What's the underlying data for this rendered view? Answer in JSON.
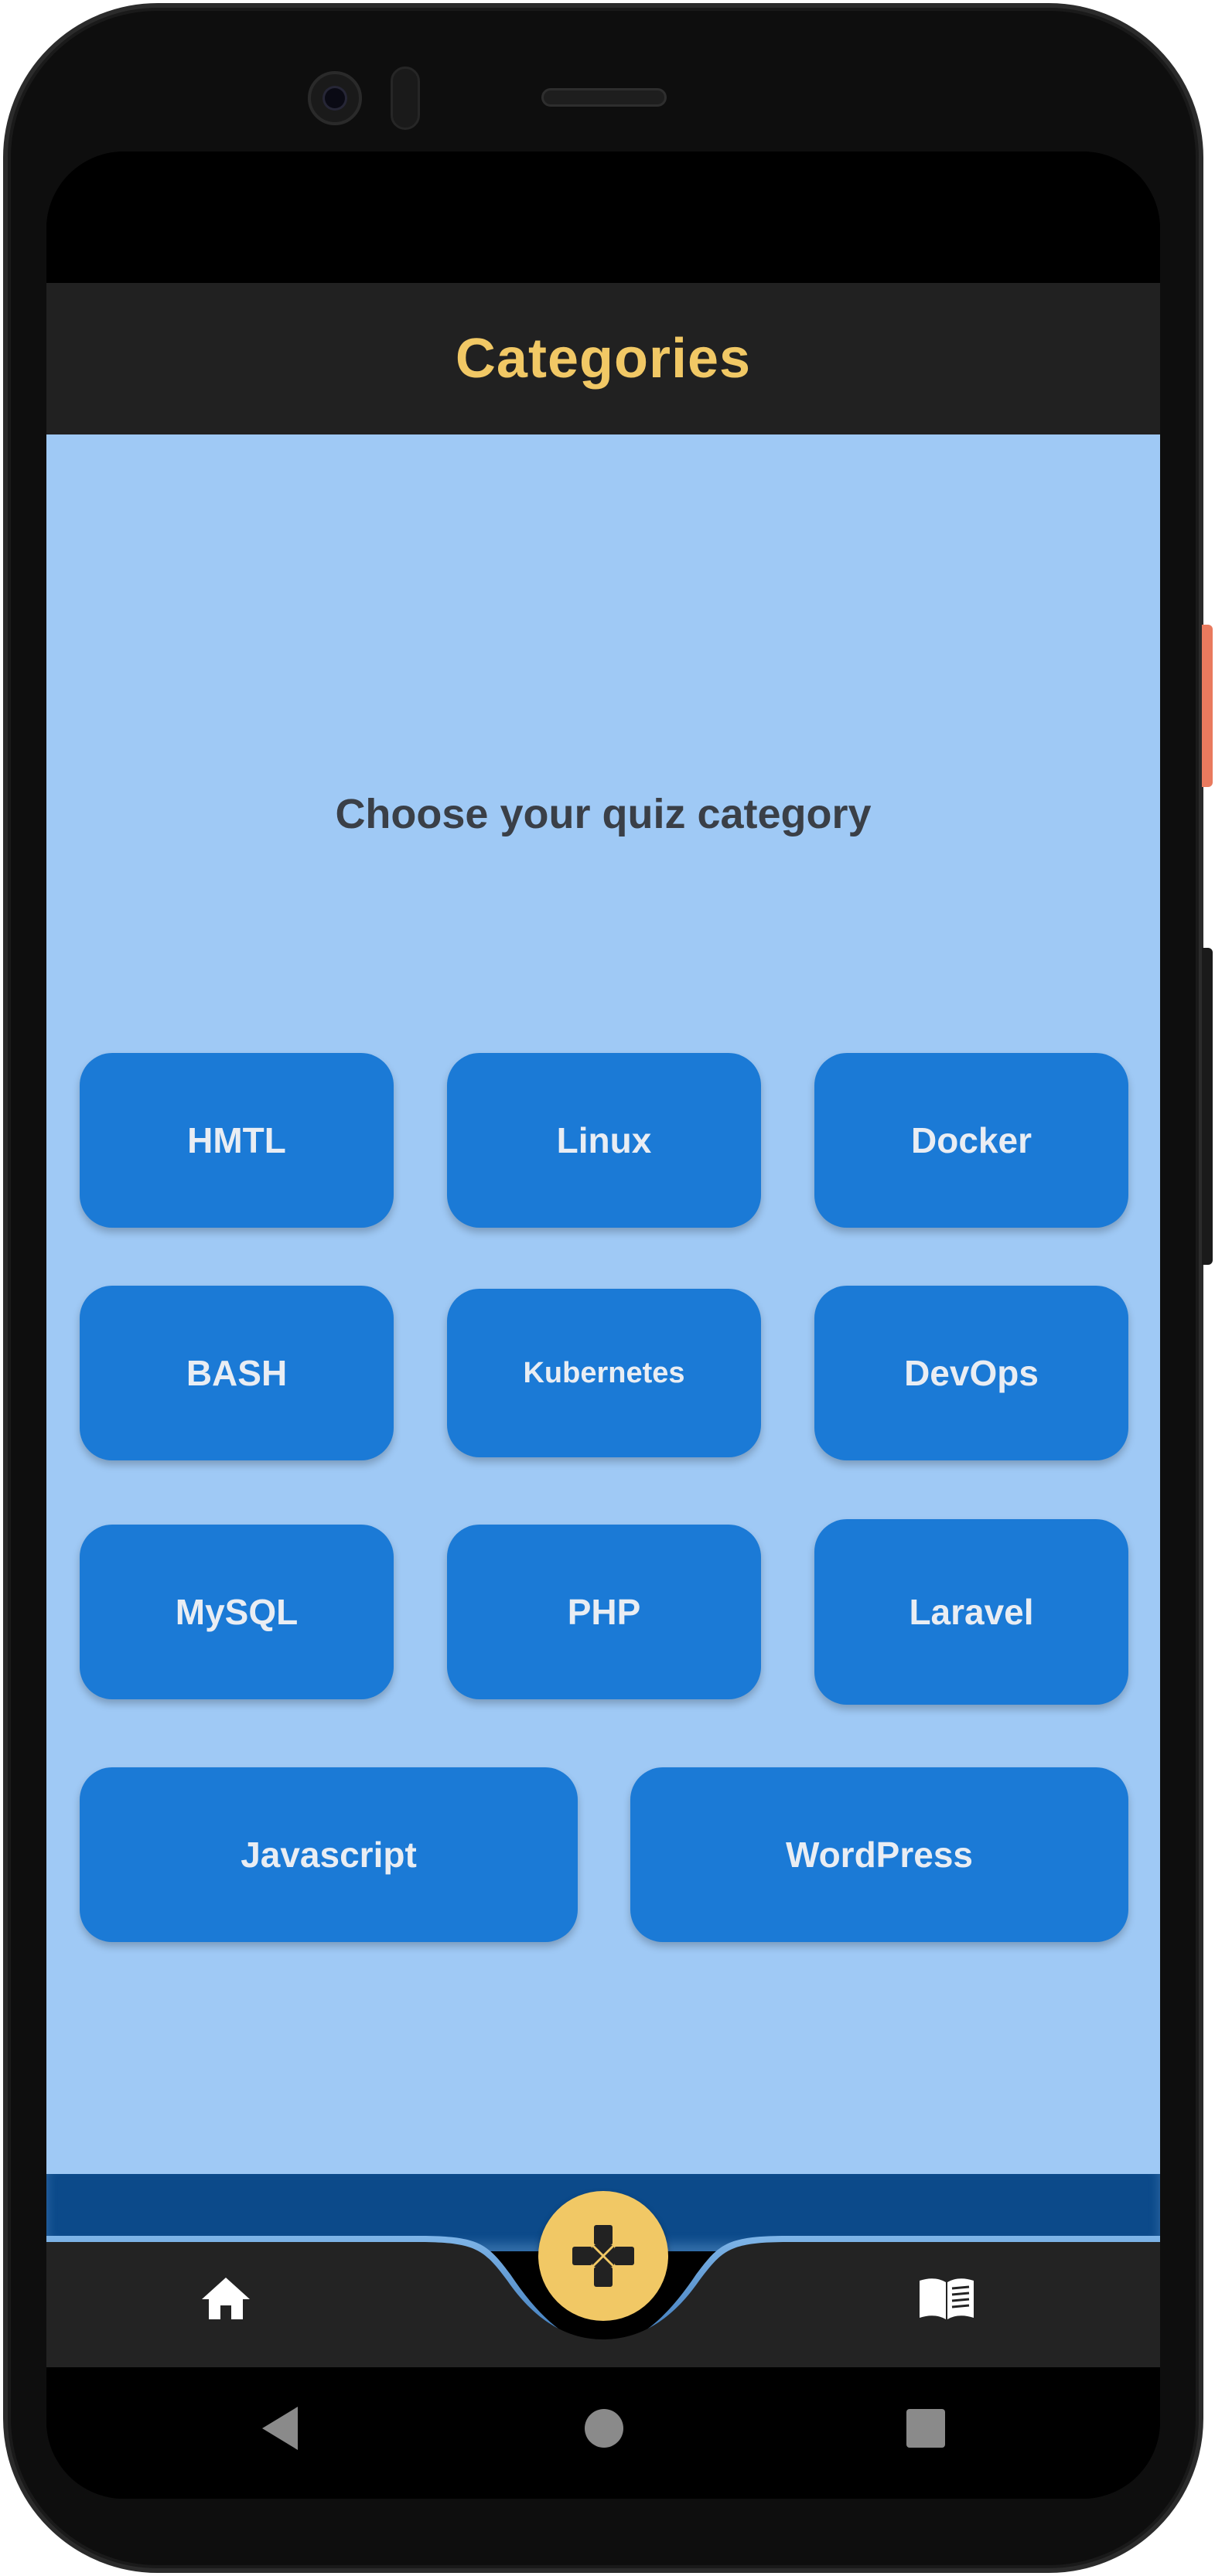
{
  "app_bar": {
    "title": "Categories"
  },
  "main": {
    "prompt": "Choose your quiz category",
    "categories": [
      {
        "label": "HMTL"
      },
      {
        "label": "Linux"
      },
      {
        "label": "Docker"
      },
      {
        "label": "BASH"
      },
      {
        "label": "Kubernetes"
      },
      {
        "label": "DevOps"
      },
      {
        "label": "MySQL"
      },
      {
        "label": "PHP"
      },
      {
        "label": "Laravel"
      },
      {
        "label": "Javascript"
      },
      {
        "label": "WordPress"
      }
    ]
  },
  "bottom_nav": {
    "items": [
      {
        "icon": "home-icon"
      },
      {
        "icon": "gamepad-icon"
      },
      {
        "icon": "book-icon"
      }
    ]
  },
  "system_nav": {
    "items": [
      {
        "icon": "back-icon"
      },
      {
        "icon": "home-circle-icon"
      },
      {
        "icon": "recents-icon"
      }
    ]
  },
  "colors": {
    "app_bar_bg": "#212121",
    "title": "#f1c865",
    "content_bg": "#9fc9f5",
    "button_bg": "#1b7ad6",
    "button_text": "#e9edf3",
    "prompt_text": "#3a3f47",
    "nav_accent": "#0c4a8a",
    "fab": "#f1c865"
  }
}
